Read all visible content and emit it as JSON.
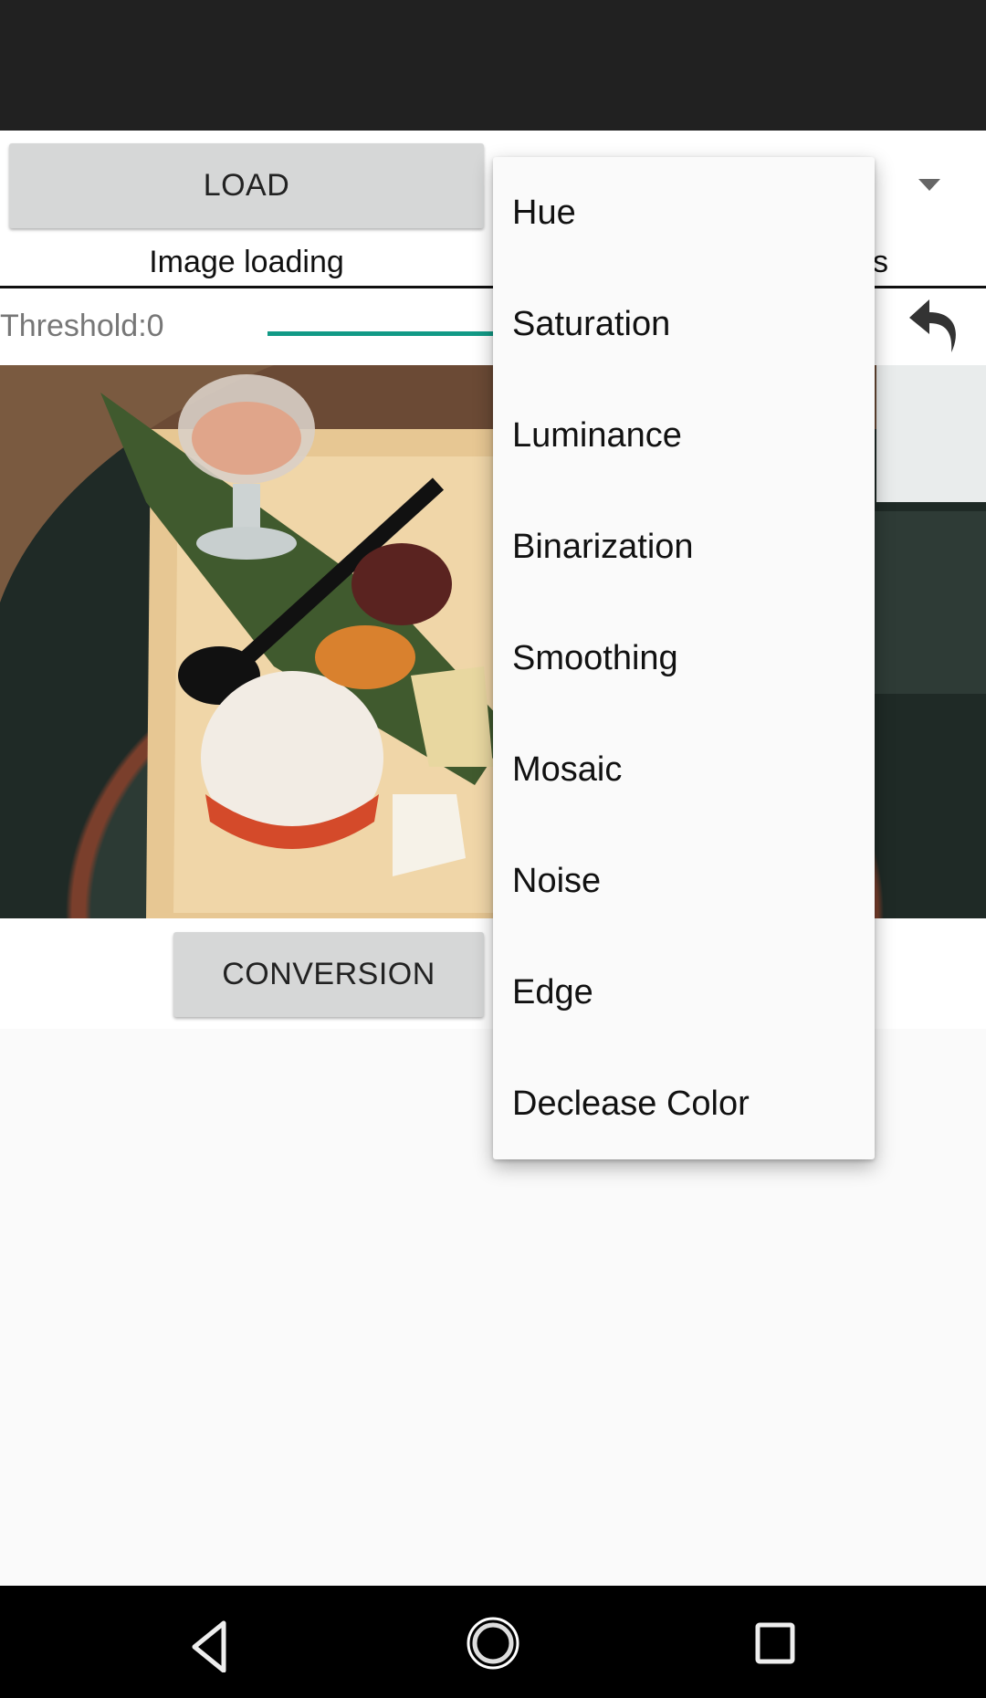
{
  "toolbar": {
    "load_label": "LOAD",
    "image_loading_label": "Image loading",
    "partially_hidden_label": "s"
  },
  "controls": {
    "threshold_label": "Threshold:0",
    "threshold_value": 0,
    "accent_color": "#129a86",
    "conversion_label": "CONVERSION"
  },
  "dropdown": {
    "items": [
      "Hue",
      "Saturation",
      "Luminance",
      "Binarization",
      "Smoothing",
      "Mosaic",
      "Noise",
      "Edge",
      "Declease Color"
    ]
  },
  "icons": {
    "spinner": "dropdown-arrow-icon",
    "undo": "undo-icon",
    "nav": [
      "back-icon",
      "home-icon",
      "recents-icon"
    ]
  }
}
